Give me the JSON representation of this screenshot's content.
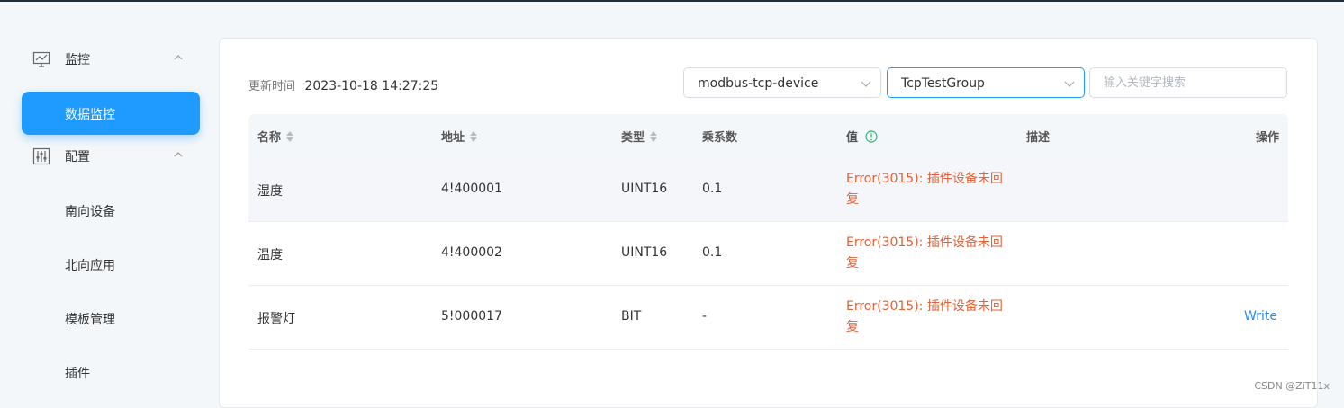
{
  "sidebar": {
    "groups": [
      {
        "label": "监控",
        "icon": "monitor-icon"
      },
      {
        "label": "配置",
        "icon": "sliders-icon"
      }
    ],
    "items": [
      {
        "label": "数据监控",
        "active": true
      },
      {
        "label": "南向设备"
      },
      {
        "label": "北向应用"
      },
      {
        "label": "模板管理"
      },
      {
        "label": "插件"
      }
    ]
  },
  "main": {
    "update_label": "更新时间",
    "update_value": "2023-10-18 14:27:25",
    "device_select": "modbus-tcp-device",
    "group_select": "TcpTestGroup",
    "search_placeholder": "输入关键字搜索"
  },
  "table": {
    "headers": {
      "name": "名称",
      "address": "地址",
      "type": "类型",
      "multiplier": "乘系数",
      "value": "值",
      "description": "描述",
      "action": "操作"
    },
    "rows": [
      {
        "name": "湿度",
        "address": "4!400001",
        "type": "UINT16",
        "multiplier": "0.1",
        "value": "Error(3015): 插件设备未回复",
        "description": "",
        "action": ""
      },
      {
        "name": "温度",
        "address": "4!400002",
        "type": "UINT16",
        "multiplier": "0.1",
        "value": "Error(3015): 插件设备未回复",
        "description": "",
        "action": ""
      },
      {
        "name": "报警灯",
        "address": "5!000017",
        "type": "BIT",
        "multiplier": "-",
        "value": "Error(3015): 插件设备未回复",
        "description": "",
        "action": "Write"
      }
    ]
  },
  "watermark": "CSDN @ZiT11x",
  "colors": {
    "accent": "#1f9bff",
    "error": "#e0633a",
    "link": "#2e8de6",
    "info": "#2eb872"
  }
}
